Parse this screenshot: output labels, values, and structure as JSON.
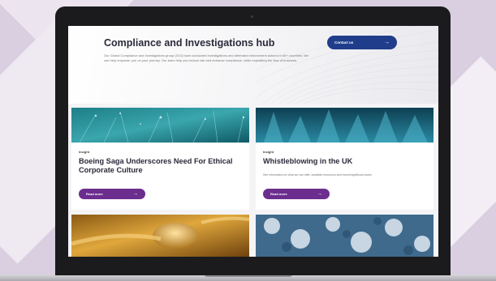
{
  "hero": {
    "title": "Compliance and Investigations hub",
    "description": "Our Global Compliance and Investigations group (GCI) have conducted investigations and defended enforcement actions in 60+ countries. We can help empower you on your journey. Our team help you reduce risk and enhance compliance, while expediting the flow of business.",
    "contact_label": "Contact us",
    "arrow": "→"
  },
  "cards": [
    {
      "tag": "Insight",
      "title": "Boeing Saga Underscores Need For Ethical Corporate Culture",
      "description": "",
      "button_label": "Read more",
      "arrow": "→"
    },
    {
      "tag": "Insight",
      "title": "Whistleblowing in the UK",
      "description": "See information on what we can offer, available resources and recent/significant cases",
      "button_label": "Read more",
      "arrow": "→"
    }
  ],
  "colors": {
    "primary_blue": "#1f3d8a",
    "accent_purple": "#6b2d8e",
    "title_text": "#2a2a3a"
  },
  "icons": {
    "button_arrow": "arrow-right-icon"
  }
}
